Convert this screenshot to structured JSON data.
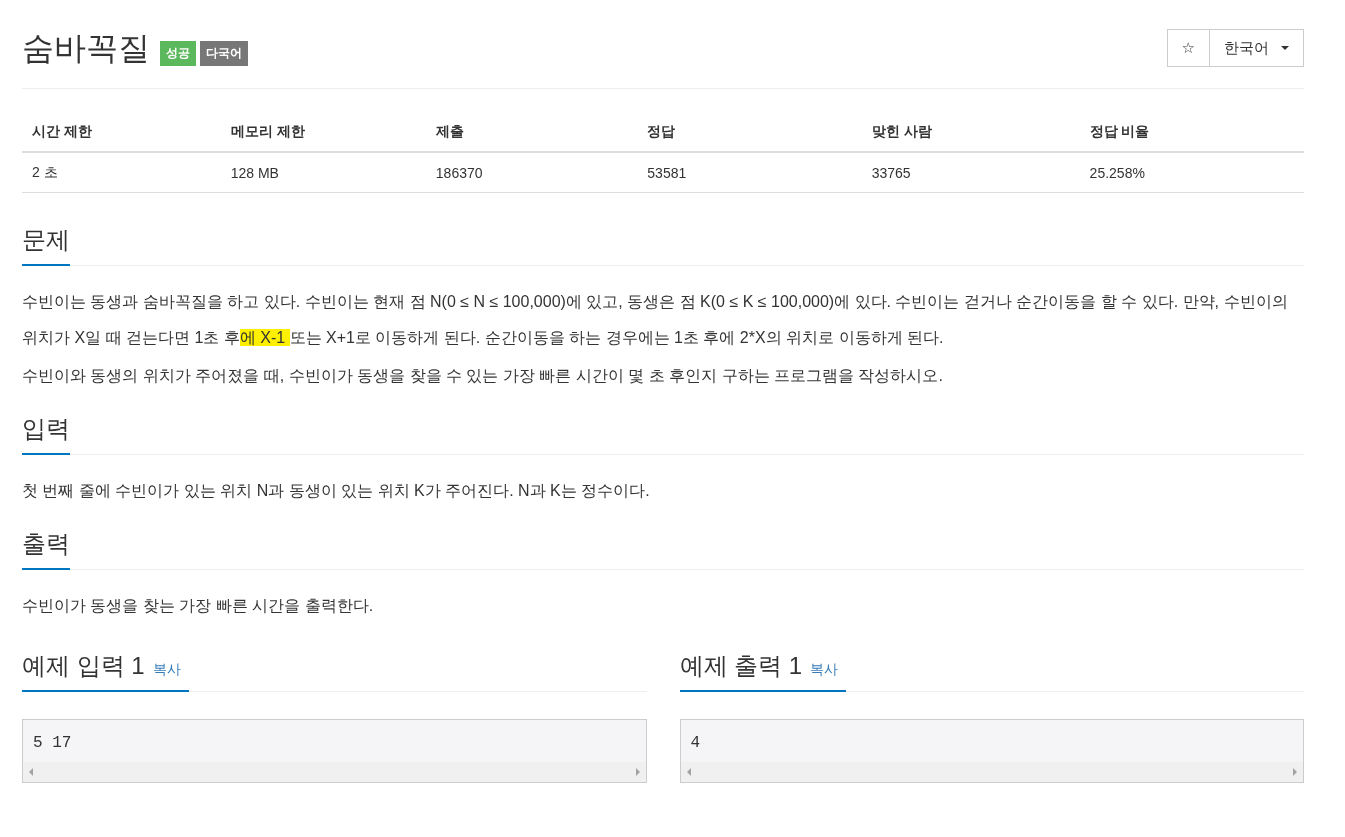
{
  "title": "숨바꼭질",
  "badges": [
    {
      "label": "성공",
      "color": "#5cb85c"
    },
    {
      "label": "다국어",
      "color": "#777777"
    }
  ],
  "star_button": {
    "label": "☆"
  },
  "language_dropdown": {
    "value": "한국어"
  },
  "info_table": {
    "columns": [
      "시간 제한",
      "메모리 제한",
      "제출",
      "정답",
      "맞힌 사람",
      "정답 비율"
    ],
    "rows": [
      [
        "2 초",
        "128 MB",
        "186370",
        "53581",
        "33765",
        "25.258%"
      ]
    ]
  },
  "sections": [
    {
      "heading": "문제",
      "paragraphs": [
        [
          {
            "text": "수빈이는 동생과 숨바꼭질을 하고 있다. 수빈이는 현재 점 N(0 ≤ N ≤ 100,000)에 있고, 동생은 점 K(0 ≤ K ≤ 100,000)에 있다. 수빈이는 걷거나 순간이동을 할 수 있다. 만약, 수빈이의 위치가 X일 때 걷는다면 1초 후",
            "highlighted": false
          },
          {
            "text": "에 X-1 ",
            "highlighted": true
          },
          {
            "text": "또는 X+1로 이동하게 된다. 순간이동을 하는 경우에는 1초 후에 2*X의 위치로 이동하게 된다.",
            "highlighted": false
          }
        ],
        [
          {
            "text": "수빈이와 동생의 위치가 주어졌을 때, 수빈이가 동생을 찾을 수 있는 가장 빠른 시간이 몇 초 후인지 구하는 프로그램을 작성하시오.",
            "highlighted": false
          }
        ]
      ]
    },
    {
      "heading": "입력",
      "paragraphs": [
        [
          {
            "text": "첫 번째 줄에 수빈이가 있는 위치 N과 동생이 있는 위치 K가 주어진다. N과 K는 정수이다.",
            "highlighted": false
          }
        ]
      ]
    },
    {
      "heading": "출력",
      "paragraphs": [
        [
          {
            "text": "수빈이가 동생을 찾는 가장 빠른 시간을 출력한다.",
            "highlighted": false
          }
        ]
      ]
    }
  ],
  "samples": [
    {
      "heading": "예제 입력 1",
      "copy_link": "복사",
      "content": "5 17"
    },
    {
      "heading": "예제 출력 1",
      "copy_link": "복사",
      "content": "4"
    }
  ]
}
